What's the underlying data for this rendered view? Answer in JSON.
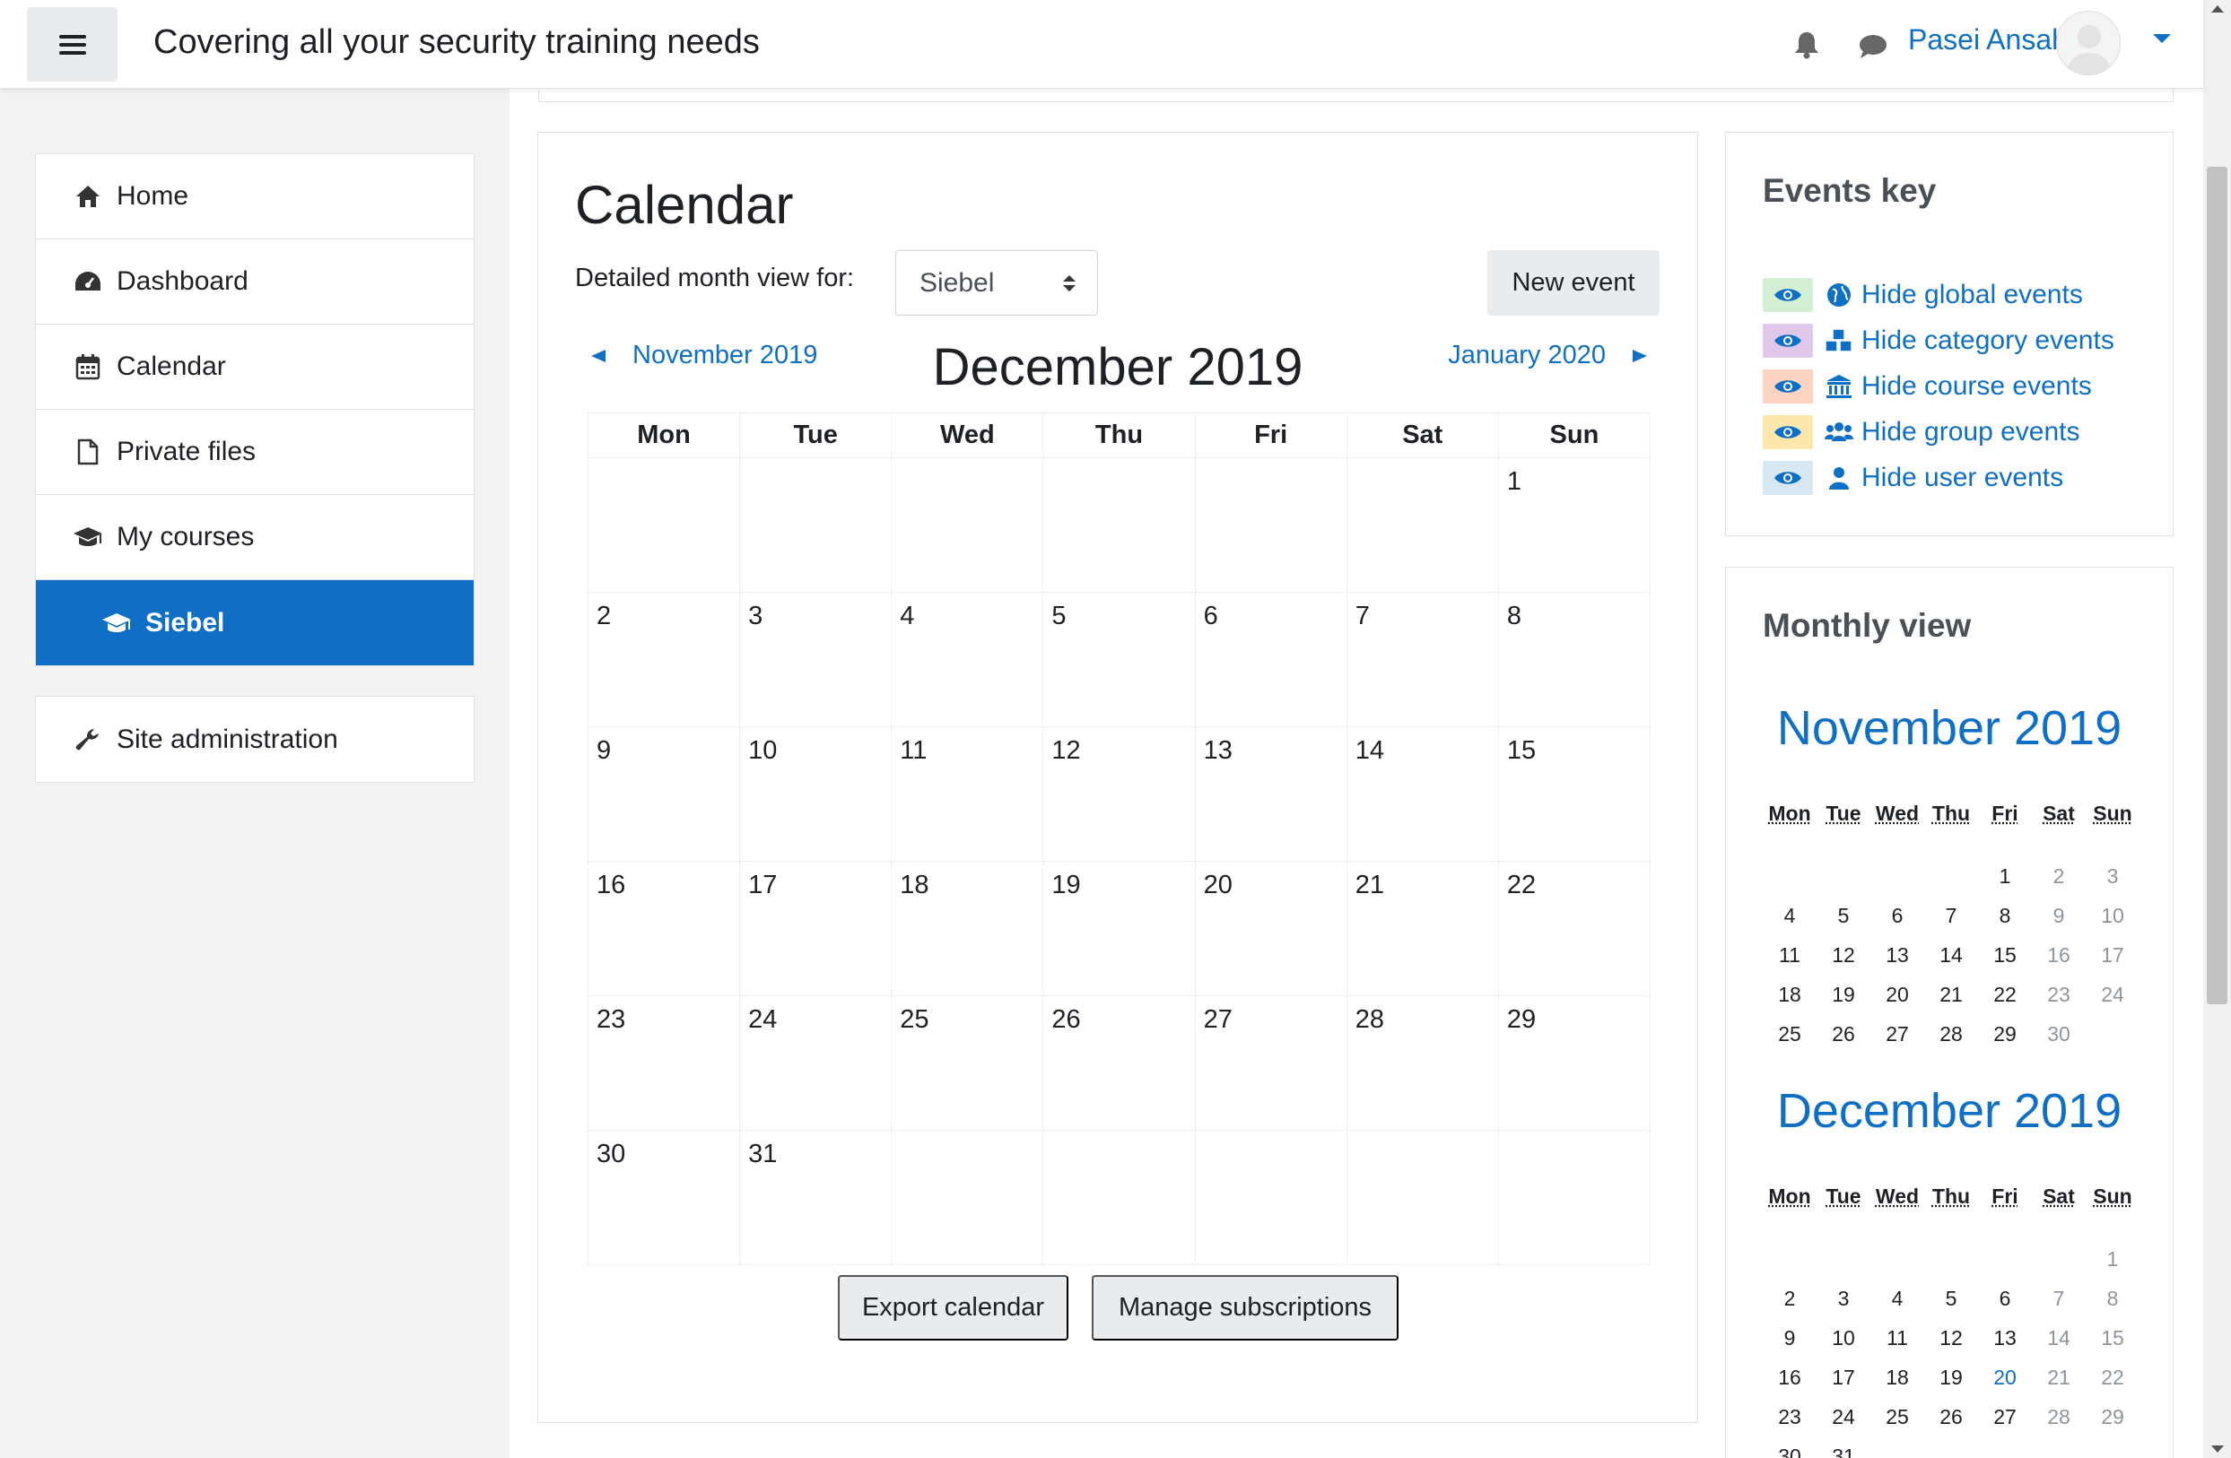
{
  "navbar": {
    "site_name": "Covering all your security training needs",
    "user_name": "Pasei Ansah",
    "icons": [
      "menu-icon",
      "bell-icon",
      "chat-icon",
      "avatar",
      "caret-down-icon"
    ]
  },
  "drawer": {
    "items": [
      {
        "label": "Home",
        "icon": "home-icon"
      },
      {
        "label": "Dashboard",
        "icon": "dashboard-icon"
      },
      {
        "label": "Calendar",
        "icon": "calendar-icon"
      },
      {
        "label": "Private files",
        "icon": "file-icon"
      },
      {
        "label": "My courses",
        "icon": "graduation-cap-icon"
      },
      {
        "label": "Siebel",
        "icon": "graduation-cap-icon",
        "active": true
      }
    ],
    "admin": {
      "label": "Site administration",
      "icon": "wrench-icon"
    }
  },
  "calendar": {
    "title": "Calendar",
    "detail_label": "Detailed month view for:",
    "course_select": "Siebel",
    "new_event": "New event",
    "prev_month": "November 2019",
    "next_month": "January 2020",
    "month": "December 2019",
    "weekdays": [
      "Mon",
      "Tue",
      "Wed",
      "Thu",
      "Fri",
      "Sat",
      "Sun"
    ],
    "weeks": [
      [
        "",
        "",
        "",
        "",
        "",
        "",
        "1"
      ],
      [
        "2",
        "3",
        "4",
        "5",
        "6",
        "7",
        "8"
      ],
      [
        "9",
        "10",
        "11",
        "12",
        "13",
        "14",
        "15"
      ],
      [
        "16",
        "17",
        "18",
        "19",
        "20",
        "21",
        "22"
      ],
      [
        "23",
        "24",
        "25",
        "26",
        "27",
        "28",
        "29"
      ],
      [
        "30",
        "31",
        "",
        "",
        "",
        "",
        ""
      ]
    ],
    "export_label": "Export calendar",
    "manage_label": "Manage subscriptions"
  },
  "events_key": {
    "title": "Events key",
    "items": [
      {
        "label": "Hide global events",
        "swatch": "#d4f0d4",
        "icon": "globe-icon"
      },
      {
        "label": "Hide category events",
        "swatch": "#e0c8ea",
        "icon": "cubes-icon"
      },
      {
        "label": "Hide course events",
        "swatch": "#fbd3c0",
        "icon": "university-icon"
      },
      {
        "label": "Hide group events",
        "swatch": "#fde7ad",
        "icon": "users-icon"
      },
      {
        "label": "Hide user events",
        "swatch": "#d7e8f3",
        "icon": "user-icon"
      }
    ]
  },
  "monthly_view": {
    "title": "Monthly view",
    "weekday_headers": [
      "Mon",
      "Tue",
      "Wed",
      "Thu",
      "Fri",
      "Sat",
      "Sun"
    ],
    "months": [
      {
        "name": "November 2019",
        "weeks": [
          [
            "",
            "",
            "",
            "",
            "1",
            "2",
            "3"
          ],
          [
            "4",
            "5",
            "6",
            "7",
            "8",
            "9",
            "10"
          ],
          [
            "11",
            "12",
            "13",
            "14",
            "15",
            "16",
            "17"
          ],
          [
            "18",
            "19",
            "20",
            "21",
            "22",
            "23",
            "24"
          ],
          [
            "25",
            "26",
            "27",
            "28",
            "29",
            "30",
            ""
          ]
        ]
      },
      {
        "name": "December 2019",
        "today": "20",
        "weeks": [
          [
            "",
            "",
            "",
            "",
            "",
            "",
            "1"
          ],
          [
            "2",
            "3",
            "4",
            "5",
            "6",
            "7",
            "8"
          ],
          [
            "9",
            "10",
            "11",
            "12",
            "13",
            "14",
            "15"
          ],
          [
            "16",
            "17",
            "18",
            "19",
            "20",
            "21",
            "22"
          ],
          [
            "23",
            "24",
            "25",
            "26",
            "27",
            "28",
            "29"
          ],
          [
            "30",
            "31",
            "",
            "",
            "",
            "",
            ""
          ]
        ]
      }
    ]
  },
  "colors": {
    "accent": "#0f6fc5",
    "button_bg": "#e9ecef",
    "border": "#dee2e6"
  }
}
